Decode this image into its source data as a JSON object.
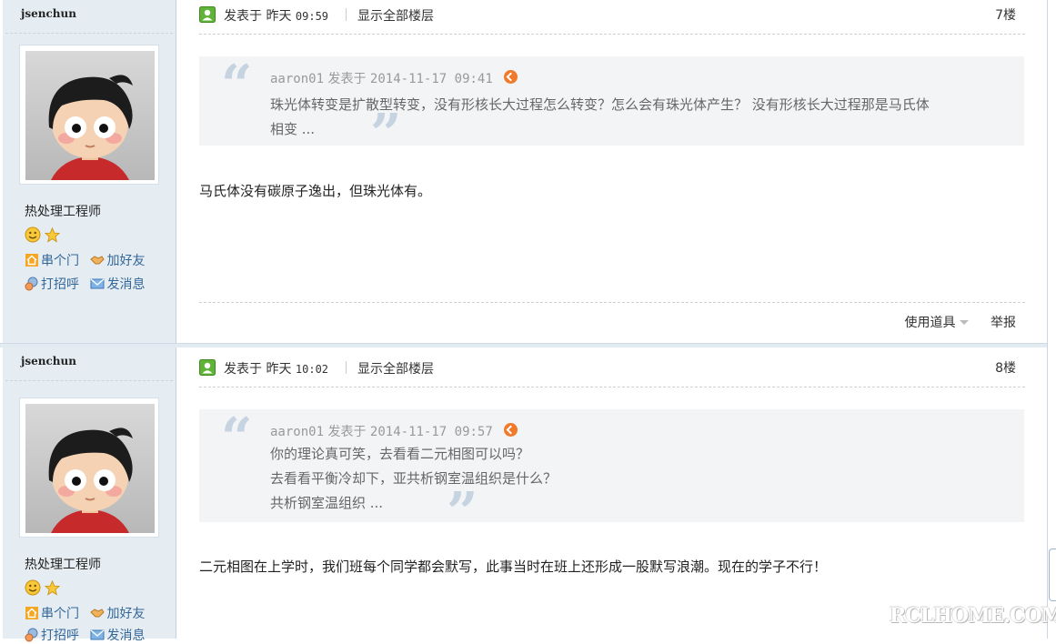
{
  "posts": [
    {
      "author": "jsenchun",
      "rank": "热处理工程师",
      "links": {
        "visit": "串个门",
        "add_friend": "加好友",
        "greet": "打招呼",
        "message": "发消息"
      },
      "posted_label": "发表于",
      "time_day": "昨天",
      "time": "09:59",
      "show_all": "显示全部楼层",
      "floor": "7楼",
      "quote": {
        "user": "aaron01",
        "posted_label": "发表于",
        "datetime": "2014-11-17 09:41",
        "lines": [
          "珠光体转变是扩散型转变，没有形核长大过程怎么转变？怎么会有珠光体产生？ 没有形核长大过程那是马氏体",
          "相变 ..."
        ]
      },
      "content": "马氏体没有碳原子逸出，但珠光体有。",
      "tools_label": "使用道具",
      "report_label": "举报"
    },
    {
      "author": "jsenchun",
      "rank": "热处理工程师",
      "links": {
        "visit": "串个门",
        "add_friend": "加好友",
        "greet": "打招呼",
        "message": "发消息"
      },
      "posted_label": "发表于",
      "time_day": "昨天",
      "time": "10:02",
      "show_all": "显示全部楼层",
      "floor": "8楼",
      "quote": {
        "user": "aaron01",
        "posted_label": "发表于",
        "datetime": "2014-11-17 09:57",
        "lines": [
          "你的理论真可笑，去看看二元相图可以吗？",
          "去看看平衡冷却下，亚共析钢室温组织是什么？",
          "共析钢室温组织 ..."
        ]
      },
      "content": "二元相图在上学时，我们班每个同学都会默写，此事当时在班上还形成一股默写浪潮。现在的学子不行！"
    }
  ],
  "watermark": "RCLHOME.COM",
  "colors": {
    "sidebar_bg": "#e5edf2",
    "quote_bg": "#f2f4f6",
    "link": "#336699",
    "quote_mark": "#c6d3e0"
  }
}
